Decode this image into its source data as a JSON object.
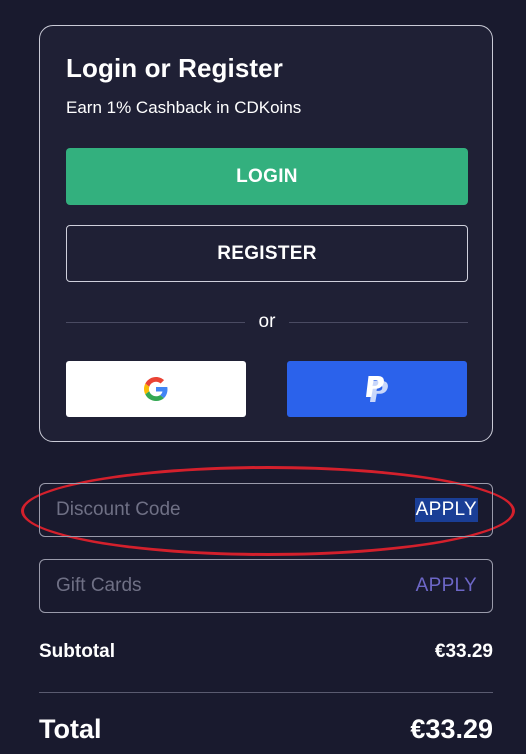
{
  "login_card": {
    "title": "Login or Register",
    "subtitle": "Earn 1% Cashback in CDKoins",
    "login_label": "LOGIN",
    "register_label": "REGISTER",
    "divider_text": "or",
    "social": [
      {
        "name": "google",
        "icon": "google-icon"
      },
      {
        "name": "paypal",
        "icon": "paypal-icon"
      }
    ]
  },
  "discount": {
    "placeholder": "Discount Code",
    "value": "",
    "apply_label": "APPLY"
  },
  "gift_cards": {
    "placeholder": "Gift Cards",
    "value": "",
    "apply_label": "APPLY"
  },
  "summary": {
    "subtotal_label": "Subtotal",
    "subtotal_value": "€33.29",
    "total_label": "Total",
    "total_value": "€33.29"
  },
  "colors": {
    "background": "#191a2e",
    "login_green": "#33b07e",
    "paypal_blue": "#2b62eb",
    "apply_purple": "#6d67c7",
    "highlight_red": "#d4202c"
  }
}
